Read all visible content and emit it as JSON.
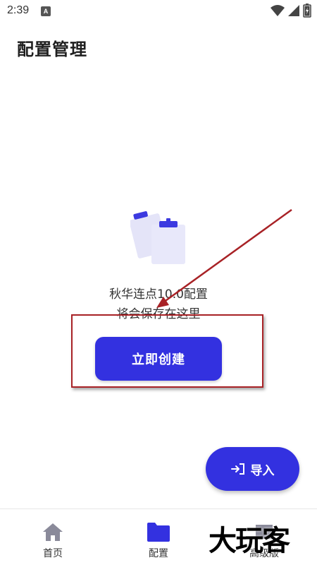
{
  "status_bar": {
    "time": "2:39",
    "notification_badge": "A",
    "icons": [
      "wifi-icon",
      "signal-icon",
      "battery-icon"
    ]
  },
  "page": {
    "title": "配置管理"
  },
  "empty_state": {
    "illustration_icon": "clipboard-icon",
    "line1": "秋华连点10.0配置",
    "line2": "将会保存在这里"
  },
  "create_button": {
    "label": "立即创建"
  },
  "import_button": {
    "icon": "import-icon",
    "label": "导入"
  },
  "bottom_nav": {
    "items": [
      {
        "label": "首页",
        "icon": "home-icon",
        "active": false
      },
      {
        "label": "配置",
        "icon": "folder-icon",
        "active": true
      },
      {
        "label": "高级版",
        "icon": "pro-icon",
        "active": false
      }
    ]
  },
  "watermark": {
    "text": "大玩客"
  },
  "colors": {
    "accent": "#3331e0",
    "annotation": "#a82226",
    "inactive_icon": "#8a8a9a"
  }
}
